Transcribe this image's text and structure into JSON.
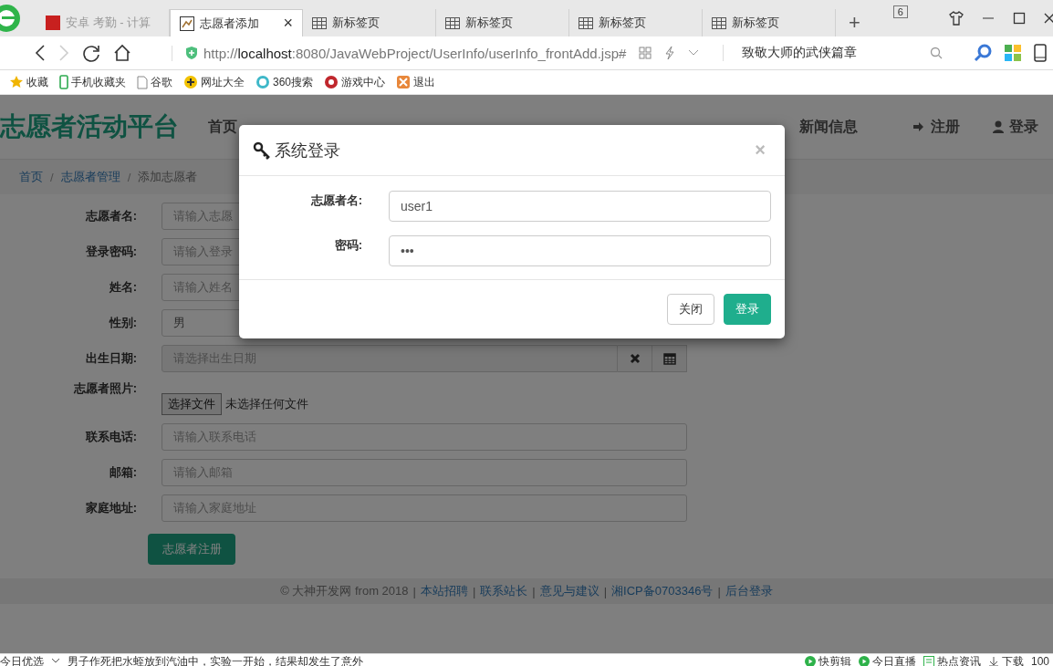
{
  "browser": {
    "tabs": [
      {
        "label": "安卓 考勤 - 计算",
        "selected": false,
        "kind": "site"
      },
      {
        "label": "志愿者添加",
        "selected": true,
        "kind": "page",
        "close": "×"
      },
      {
        "label": "新标签页",
        "selected": false,
        "kind": "blank"
      },
      {
        "label": "新标签页",
        "selected": false,
        "kind": "blank"
      },
      {
        "label": "新标签页",
        "selected": false,
        "kind": "blank"
      },
      {
        "label": "新标签页",
        "selected": false,
        "kind": "blank"
      }
    ],
    "new_tab": "+",
    "tab_count": "6",
    "nav": {
      "back_disabled": false,
      "forward_disabled": true
    },
    "url": {
      "scheme": "http://",
      "host": "localhost",
      "rest": ":8080/JavaWebProject/UserInfo/userInfo_frontAdd.jsp#"
    },
    "search": "致敬大师的武侠篇章",
    "bookmarks": [
      {
        "label": "收藏",
        "kind": "star"
      },
      {
        "label": "手机收藏夹",
        "kind": "phone"
      },
      {
        "label": "谷歌",
        "kind": "page"
      },
      {
        "label": "网址大全",
        "kind": "plus"
      },
      {
        "label": "360搜索",
        "kind": "ring"
      },
      {
        "label": "游戏中心",
        "kind": "game"
      },
      {
        "label": "退出",
        "kind": "exit"
      }
    ]
  },
  "site": {
    "brand": "志愿者活动平台",
    "nav": [
      {
        "label": "首页"
      },
      {
        "label": "新闻信息"
      }
    ],
    "auth": [
      {
        "label": "注册",
        "kind": "signin"
      },
      {
        "label": "登录",
        "kind": "user"
      }
    ],
    "breadcrumb_separator": "/",
    "footer_separator": "|",
    "breadcrumb": [
      {
        "label": "首页",
        "link": true
      },
      {
        "label": "志愿者管理",
        "link": true
      },
      {
        "label": "添加志愿者",
        "link": false
      }
    ],
    "form": [
      {
        "label": "志愿者名:",
        "kind": "input",
        "placeholder": "请输入志愿"
      },
      {
        "label": "登录密码:",
        "kind": "input",
        "placeholder": "请输入登录"
      },
      {
        "label": "姓名:",
        "kind": "input",
        "placeholder": "请输入姓名"
      },
      {
        "label": "性别:",
        "kind": "select",
        "value": "男"
      },
      {
        "label": "出生日期:",
        "kind": "date",
        "placeholder": "请选择出生日期"
      },
      {
        "label": "志愿者照片:",
        "kind": "file",
        "button": "选择文件",
        "value": "未选择任何文件"
      },
      {
        "label": "联系电话:",
        "kind": "input",
        "placeholder": "请输入联系电话"
      },
      {
        "label": "邮箱:",
        "kind": "input",
        "placeholder": "请输入邮箱"
      },
      {
        "label": "家庭地址:",
        "kind": "input",
        "placeholder": "请输入家庭地址"
      }
    ],
    "submit": "志愿者注册",
    "footer": [
      "© 大神开发网 from 2018",
      "本站招聘",
      "联系站长",
      "意见与建议",
      "湘ICP备0703346号",
      "后台登录"
    ]
  },
  "modal": {
    "title": "系统登录",
    "close": "×",
    "fields": [
      {
        "label": "志愿者名:",
        "value": "user1"
      },
      {
        "label": "密码:",
        "value": "•••"
      }
    ],
    "buttons": [
      {
        "label": "关闭",
        "kind": "default"
      },
      {
        "label": "登录",
        "kind": "primary"
      }
    ]
  },
  "status_bar": {
    "left": "今日优选",
    "headline": "男子作死把水蛭放到汽油中，实验一开始，结果却发生了意外",
    "items": [
      {
        "label": "快剪辑",
        "kind": "play"
      },
      {
        "label": "今日直播",
        "kind": "play"
      },
      {
        "label": "热点资讯",
        "kind": "news"
      },
      {
        "label": "下载",
        "kind": "download"
      }
    ],
    "zoom": "100"
  }
}
